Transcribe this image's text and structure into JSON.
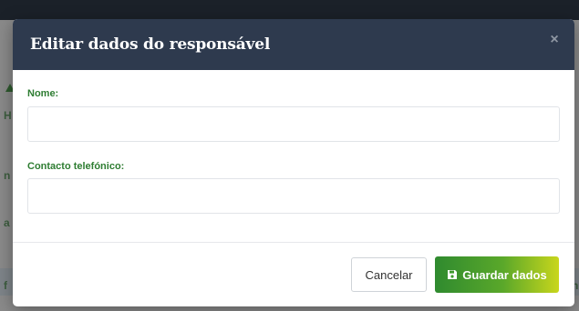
{
  "modal": {
    "title": "Editar dados do responsável",
    "close_symbol": "×",
    "fields": [
      {
        "label": "Nome:",
        "value": "",
        "placeholder": ""
      },
      {
        "label": "Contacto telefónico:",
        "value": "",
        "placeholder": ""
      }
    ],
    "buttons": {
      "cancel_label": "Cancelar",
      "save_label": "Guardar dados",
      "save_icon": "floppy-disk-icon"
    }
  },
  "background": {
    "fragments": [
      "H",
      "n",
      "a",
      "f",
      "n"
    ]
  },
  "colors": {
    "header_bg": "#2e3a4e",
    "label_green": "#2e7d32",
    "save_gradient_start": "#2f8a2f",
    "save_gradient_end": "#c9d61c"
  }
}
